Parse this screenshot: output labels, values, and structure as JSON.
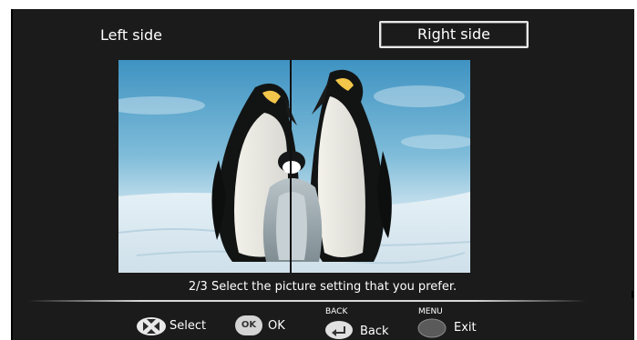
{
  "options": {
    "left_label": "Left side",
    "right_label": "Right side",
    "selected": "Right side"
  },
  "instruction": "2/3 Select the picture setting that you prefer.",
  "footer": {
    "select_label": "Select",
    "ok_badge": "OK",
    "ok_label": "OK",
    "back_caption": "BACK",
    "back_label": "Back",
    "menu_caption": "MENU",
    "exit_label": "Exit"
  },
  "icons": {
    "navigation": "dpad-icon",
    "ok": "ok-button-icon",
    "back": "back-arrow-icon",
    "menu": "menu-button-icon"
  },
  "colors": {
    "background": "#1b1b1b",
    "text": "#ffffff",
    "highlight_border": "#e8e8e8"
  }
}
